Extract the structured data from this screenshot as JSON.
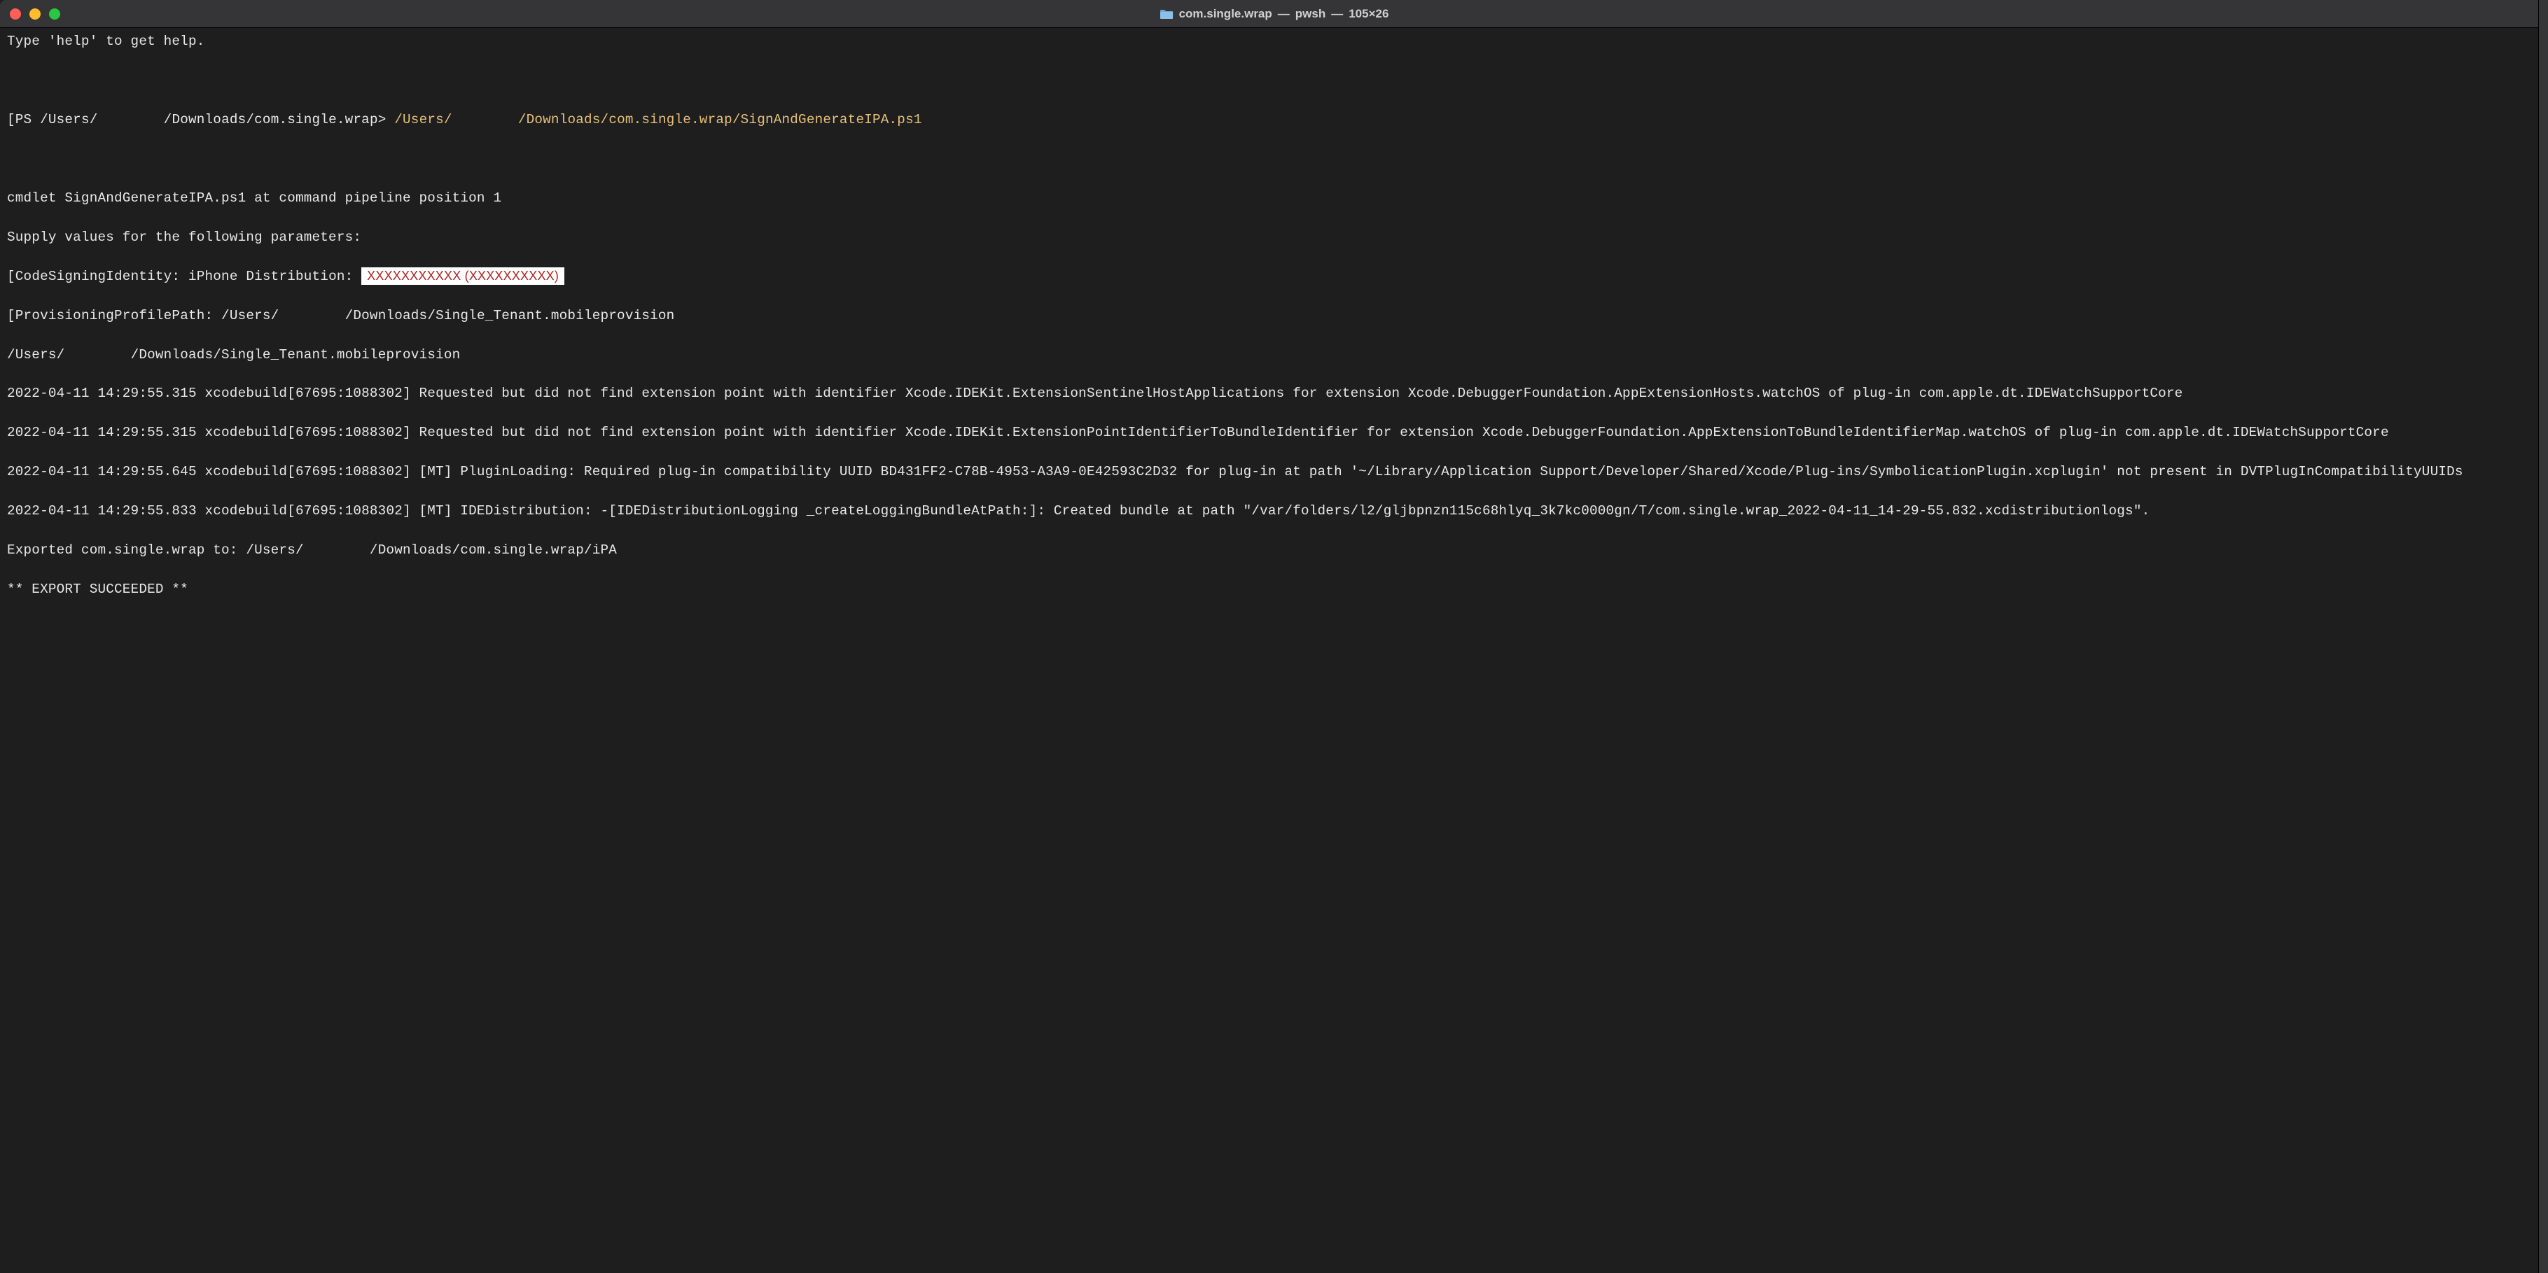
{
  "titlebar": {
    "folder_name": "com.single.wrap",
    "process": "pwsh",
    "dimensions": "105×26"
  },
  "terminal": {
    "help_line": "Type 'help' to get help.",
    "prompt_prefix": "PS /Users/",
    "prompt_path": "/Downloads/com.single.wrap>",
    "script_path_1": "/Users/",
    "script_path_2": "/Downloads/com.single.wrap/SignAndGenerateIPA.ps1",
    "cmdlet_line": "cmdlet SignAndGenerateIPA.ps1 at command pipeline position 1",
    "supply_line": "Supply values for the following parameters:",
    "codesign_label": "CodeSigningIdentity: iPhone Distribution: ",
    "codesign_redacted": "XXXXXXXXXXX (XXXXXXXXXX)",
    "provprofile_label": "ProvisioningProfilePath: /Users/",
    "provprofile_path": "/Downloads/Single_Tenant.mobileprovision",
    "echo_users": "/Users/",
    "echo_path": "/Downloads/Single_Tenant.mobileprovision",
    "log1": "2022-04-11 14:29:55.315 xcodebuild[67695:1088302] Requested but did not find extension point with identifier Xcode.IDEKit.ExtensionSentinelHostApplications for extension Xcode.DebuggerFoundation.AppExtensionHosts.watchOS of plug-in com.apple.dt.IDEWatchSupportCore",
    "log2": "2022-04-11 14:29:55.315 xcodebuild[67695:1088302] Requested but did not find extension point with identifier Xcode.IDEKit.ExtensionPointIdentifierToBundleIdentifier for extension Xcode.DebuggerFoundation.AppExtensionToBundleIdentifierMap.watchOS of plug-in com.apple.dt.IDEWatchSupportCore",
    "log3": "2022-04-11 14:29:55.645 xcodebuild[67695:1088302] [MT] PluginLoading: Required plug-in compatibility UUID BD431FF2-C78B-4953-A3A9-0E42593C2D32 for plug-in at path '~/Library/Application Support/Developer/Shared/Xcode/Plug-ins/SymbolicationPlugin.xcplugin' not present in DVTPlugInCompatibilityUUIDs",
    "log4": "2022-04-11 14:29:55.833 xcodebuild[67695:1088302] [MT] IDEDistribution: -[IDEDistributionLogging _createLoggingBundleAtPath:]: Created bundle at path \"/var/folders/l2/gljbpnzn115c68hlyq_3k7kc0000gn/T/com.single.wrap_2022-04-11_14-29-55.832.xcdistributionlogs\".",
    "exported_1": "Exported com.single.wrap to: /Users/",
    "exported_2": "/Downloads/com.single.wrap/iPA",
    "succeeded": "** EXPORT SUCCEEDED **",
    "redact_fill": "        "
  }
}
